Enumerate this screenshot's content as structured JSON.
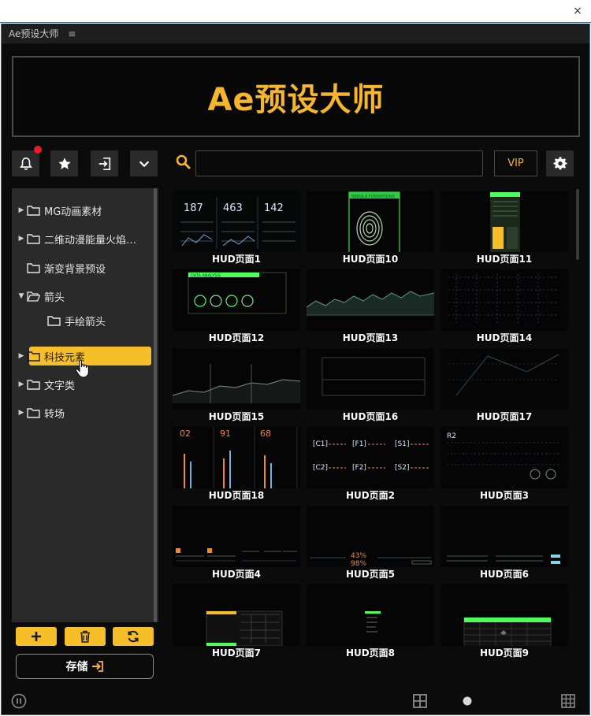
{
  "os": {
    "close_glyph": "×"
  },
  "panel": {
    "title": "Ae预设大师",
    "menu_glyph": "≡"
  },
  "banner": {
    "title": "Ae预设大师"
  },
  "toolbar": {
    "buttons": [
      "bell-icon",
      "star-icon",
      "import-icon",
      "chevron-down-icon"
    ],
    "search_value": "",
    "vip_label": "VIP",
    "notification_dot_color": "#e8192c"
  },
  "tree": {
    "items": [
      {
        "label": "MG动画素材",
        "expanded": false,
        "depth": 0,
        "has_arrow": true
      },
      {
        "label": "二维动漫能量火焰…",
        "expanded": false,
        "depth": 0,
        "has_arrow": true
      },
      {
        "label": "渐变背景预设",
        "expanded": false,
        "depth": 0,
        "has_arrow": false
      },
      {
        "label": "箭头",
        "expanded": true,
        "depth": 0,
        "has_arrow": true
      },
      {
        "label": "手绘箭头",
        "expanded": false,
        "depth": 1,
        "has_arrow": false
      },
      {
        "label": "科技元素",
        "expanded": false,
        "depth": 0,
        "has_arrow": true,
        "selected": true
      },
      {
        "label": "文字类",
        "expanded": false,
        "depth": 0,
        "has_arrow": true
      },
      {
        "label": "转场",
        "expanded": false,
        "depth": 0,
        "has_arrow": true
      }
    ]
  },
  "bottom_buttons": [
    "add-icon",
    "trash-icon",
    "refresh-icon"
  ],
  "save": {
    "label": "存储"
  },
  "thumbnails": [
    "HUD页面1",
    "HUD页面10",
    "HUD页面11",
    "HUD页面12",
    "HUD页面13",
    "HUD页面14",
    "HUD页面15",
    "HUD页面16",
    "HUD页面17",
    "HUD页面18",
    "HUD页面2",
    "HUD页面3",
    "HUD页面4",
    "HUD页面5",
    "HUD页面6",
    "HUD页面7",
    "HUD页面8",
    "HUD页面9"
  ],
  "thumb_text": {
    "t1": [
      "187",
      "463",
      "142"
    ],
    "t18": [
      "02",
      "91",
      "68"
    ],
    "t2": [
      "[C1]",
      "[F1]",
      "[S1]",
      "[C2]",
      "[F2]",
      "[S2]"
    ],
    "t3": "R2",
    "t5": [
      "43%",
      "98%"
    ],
    "t12": "DATA ANALYSIS",
    "t10": "NEBULA FORMATIONS"
  },
  "colors": {
    "accent": "#f6b52b",
    "selected": "#f6bf2a",
    "hud_green": "#4cff5a",
    "hud_orange": "#f08a2a"
  }
}
